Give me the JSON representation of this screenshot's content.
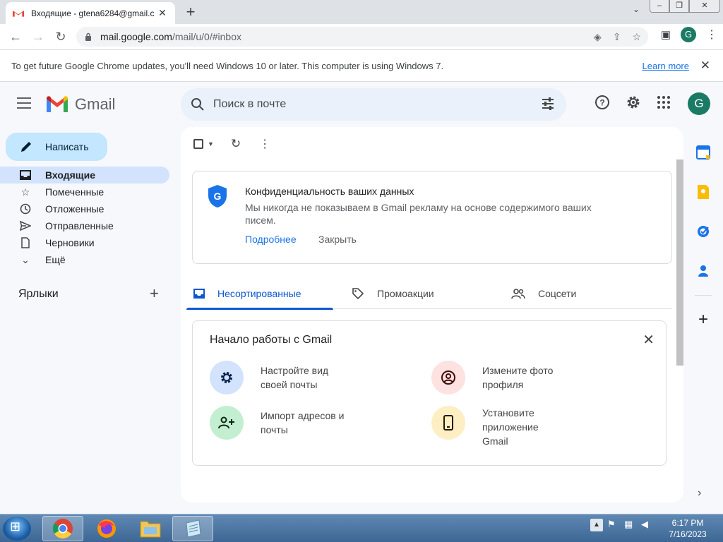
{
  "browser": {
    "tab_title": "Входящие - gtena6284@gmail.c",
    "url_host": "mail.google.com",
    "url_path": "/mail/u/0/#inbox",
    "profile_initial": "G"
  },
  "infobar": {
    "message": "To get future Google Chrome updates, you'll need Windows 10 or later. This computer is using Windows 7.",
    "learn_more": "Learn more"
  },
  "gmail": {
    "logo_text": "Gmail",
    "search_placeholder": "Поиск в почте",
    "avatar_initial": "G",
    "compose_label": "Написать",
    "nav": [
      {
        "label": "Входящие"
      },
      {
        "label": "Помеченные"
      },
      {
        "label": "Отложенные"
      },
      {
        "label": "Отправленные"
      },
      {
        "label": "Черновики"
      },
      {
        "label": "Ещё"
      }
    ],
    "labels_heading": "Ярлыки",
    "privacy": {
      "title": "Конфиденциальность ваших данных",
      "body": "Мы никогда не показываем в Gmail рекламу на основе содержимого ваших писем.",
      "more": "Подробнее",
      "close": "Закрыть"
    },
    "tabs": [
      {
        "label": "Несортированные"
      },
      {
        "label": "Промоакции"
      },
      {
        "label": "Соцсети"
      }
    ],
    "getting_started": {
      "title": "Начало работы с Gmail",
      "items": [
        {
          "label": "Настройте вид своей почты"
        },
        {
          "label": "Измените фото профиля"
        },
        {
          "label": "Импорт адресов и почты"
        },
        {
          "label": "Установите приложение Gmail"
        }
      ]
    }
  },
  "taskbar": {
    "time": "6:17 PM",
    "date": "7/16/2023"
  }
}
